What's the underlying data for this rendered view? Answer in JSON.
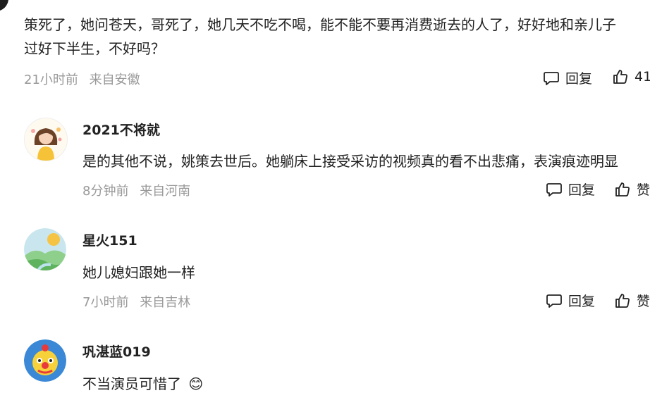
{
  "top_comment": {
    "text_line1": "策死了，她问苍天，哥死了，她几天不吃不喝，能不能不要再消费逝去的人了，好好地和亲儿子",
    "text_line2": "过好下半生，不好吗？",
    "time": "21小时前",
    "location": "来自安徽",
    "reply_label": "回复",
    "like_count": "41"
  },
  "replies": [
    {
      "username": "2021不将就",
      "text": "是的其他不说，姚策去世后。她躺床上接受采访的视频真的看不出悲痛，表演痕迹明显",
      "time": "8分钟前",
      "location": "来自河南",
      "reply_label": "回复",
      "like_label": "赞"
    },
    {
      "username": "星火151",
      "text": "她儿媳妇跟她一样",
      "time": "7小时前",
      "location": "来自吉林",
      "reply_label": "回复",
      "like_label": "赞"
    },
    {
      "username": "巩湛蓝019",
      "text": "不当演员可惜了",
      "emoji": "😊"
    }
  ],
  "icons": {
    "reply": "comment-bubble-icon",
    "like": "thumbs-up-icon"
  }
}
